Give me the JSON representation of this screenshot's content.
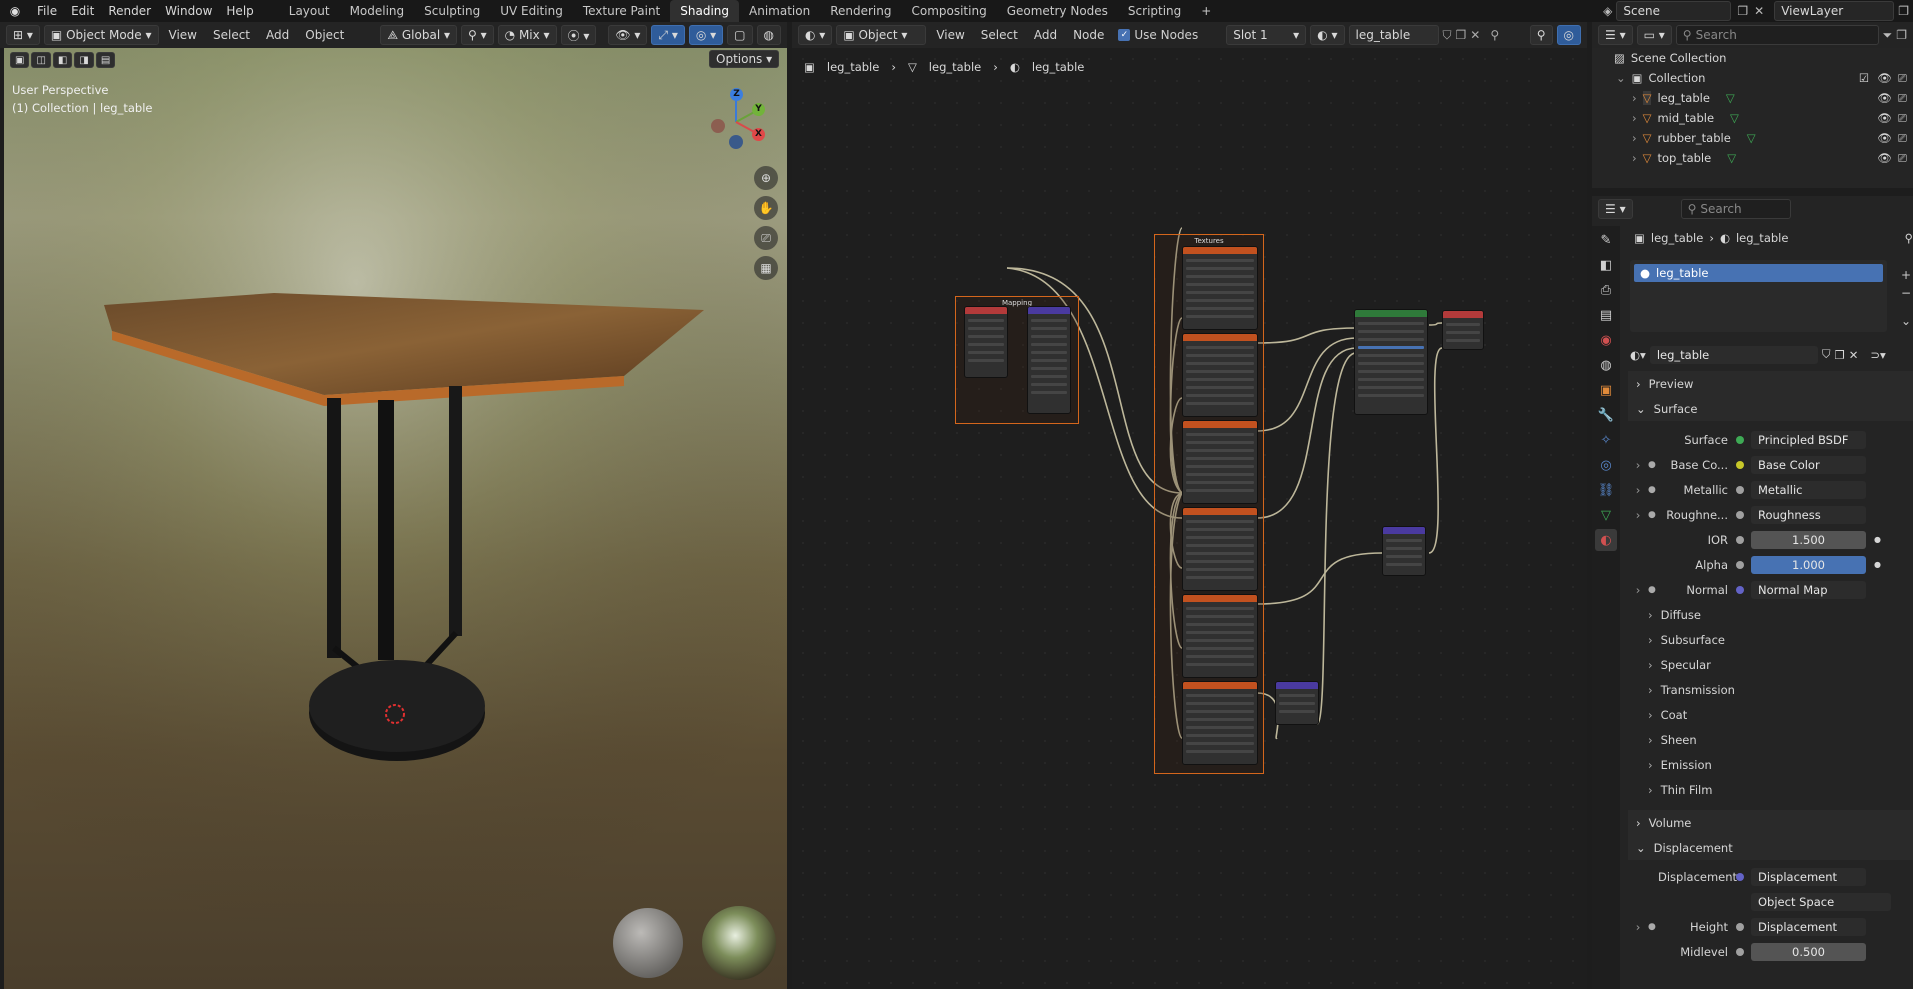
{
  "app": {
    "menu": [
      "File",
      "Edit",
      "Render",
      "Window",
      "Help"
    ],
    "workspaces": [
      "Layout",
      "Modeling",
      "Sculpting",
      "UV Editing",
      "Texture Paint",
      "Shading",
      "Animation",
      "Rendering",
      "Compositing",
      "Geometry Nodes",
      "Scripting"
    ],
    "active_workspace": "Shading",
    "add_tab": "+",
    "scene": "Scene",
    "view_layer": "ViewLayer"
  },
  "viewport": {
    "mode": "Object Mode",
    "menus": [
      "View",
      "Select",
      "Add",
      "Object"
    ],
    "orientation": "Global",
    "pivot": "Mix",
    "options": "Options",
    "overlay_title": "User Perspective",
    "overlay_sub": "(1) Collection | leg_table",
    "gizmo": {
      "z": "Z",
      "y": "Y",
      "x": "X"
    }
  },
  "node_editor": {
    "type": "Object",
    "menus": [
      "View",
      "Select",
      "Add",
      "Node"
    ],
    "use_nodes": "Use Nodes",
    "slot": "Slot 1",
    "material": "leg_table",
    "breadcrumbs": [
      "leg_table",
      "leg_table",
      "leg_table"
    ],
    "frames": {
      "mapping": "Mapping",
      "textures": "Textures"
    }
  },
  "outliner": {
    "search_placeholder": "Search",
    "scene_collection": "Scene Collection",
    "collection": "Collection",
    "objects": [
      "leg_table",
      "mid_table",
      "rubber_table",
      "top_table"
    ]
  },
  "properties": {
    "search_placeholder": "Search",
    "breadcrumb": [
      "leg_table",
      "leg_table"
    ],
    "slot_item": "leg_table",
    "material_name": "leg_table",
    "sections": {
      "preview": "Preview",
      "surface": "Surface",
      "volume": "Volume",
      "displacement": "Displacement"
    },
    "surface_rows": [
      {
        "label": "Surface",
        "value": "Principled BSDF",
        "dot": "#3eaa55"
      },
      {
        "label": "Base Co...",
        "value": "Base Color",
        "dot": "#c7c729"
      },
      {
        "label": "Metallic",
        "value": "Metallic",
        "dot": "#a0a0a0"
      },
      {
        "label": "Roughne...",
        "value": "Roughness",
        "dot": "#a0a0a0"
      },
      {
        "label": "IOR",
        "value": "1.500",
        "dot": "#a0a0a0"
      },
      {
        "label": "Alpha",
        "value": "1.000",
        "dot": "#a0a0a0"
      },
      {
        "label": "Normal",
        "value": "Normal Map",
        "dot": "#6363c7"
      }
    ],
    "subpanels": [
      "Diffuse",
      "Subsurface",
      "Specular",
      "Transmission",
      "Coat",
      "Sheen",
      "Emission",
      "Thin Film"
    ],
    "displacement_rows": [
      {
        "label": "Displacement",
        "value": "Displacement",
        "dot": "#6363c7"
      },
      {
        "label": "",
        "value": "Object Space"
      },
      {
        "label": "Height",
        "value": "Displacement",
        "dot": "#a0a0a0"
      },
      {
        "label": "Midlevel",
        "value": "0.500",
        "dot": "#a0a0a0"
      }
    ]
  },
  "colors": {
    "accent": "#4772b3",
    "frame": "#d4661c",
    "texture_node": "#c2511f",
    "bsdf_node": "#2f7a3a",
    "vector_node": "#4a3aa0"
  }
}
